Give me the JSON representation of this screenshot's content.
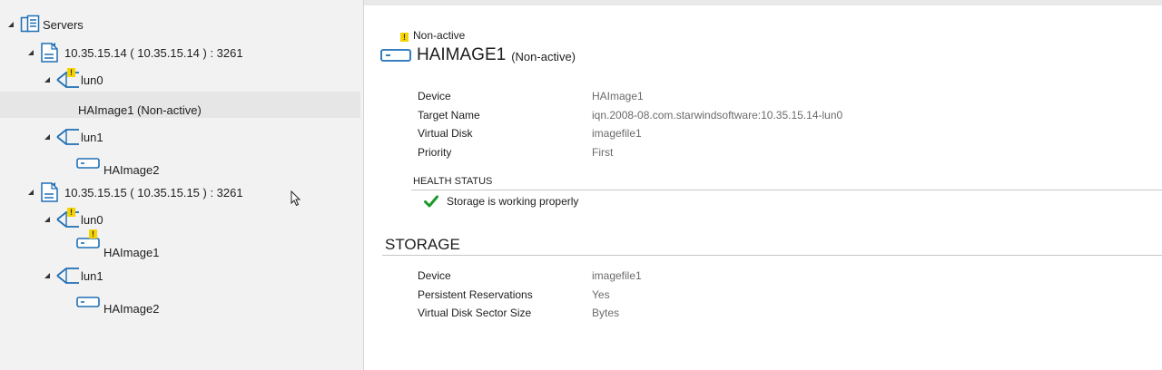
{
  "tree": {
    "root": {
      "label": "Servers"
    },
    "servers": [
      {
        "label": "10.35.15.14 ( 10.35.15.14 ) : 3261",
        "luns": [
          {
            "label": "lun0",
            "warning": true,
            "devices": [
              {
                "label": "HAImage1 (Non-active)",
                "selected": true
              }
            ]
          },
          {
            "label": "lun1",
            "warning": false,
            "devices": [
              {
                "label": "HAImage2"
              }
            ]
          }
        ]
      },
      {
        "label": "10.35.15.15 ( 10.35.15.15 ) : 3261",
        "luns": [
          {
            "label": "lun0",
            "warning": true,
            "devices": [
              {
                "label": "HAImage1",
                "warning": true
              }
            ]
          },
          {
            "label": "lun1",
            "warning": false,
            "devices": [
              {
                "label": "HAImage2"
              }
            ]
          }
        ]
      }
    ]
  },
  "detail": {
    "status_badge": "Non-active",
    "title_main": "HAIMAGE1",
    "title_sub": "(Non-active)",
    "properties": [
      {
        "label": "Device",
        "value": "HAImage1"
      },
      {
        "label": "Target Name",
        "value": "iqn.2008-08.com.starwindsoftware:10.35.15.14-lun0"
      },
      {
        "label": "Virtual Disk",
        "value": "imagefile1"
      },
      {
        "label": "Priority",
        "value": "First"
      }
    ],
    "health": {
      "heading": "HEALTH STATUS",
      "message": "Storage is working properly"
    },
    "storage": {
      "heading": "STORAGE",
      "properties": [
        {
          "label": "Device",
          "value": "imagefile1"
        },
        {
          "label": "Persistent Reservations",
          "value": "Yes"
        },
        {
          "label": "Virtual Disk Sector Size",
          "value": "Bytes"
        }
      ]
    }
  },
  "colors": {
    "accent": "#1f6fb5",
    "warning": "#f7d400",
    "ok": "#1a9a2a",
    "selection": "#e6e6e6"
  },
  "warning_glyph": "!"
}
